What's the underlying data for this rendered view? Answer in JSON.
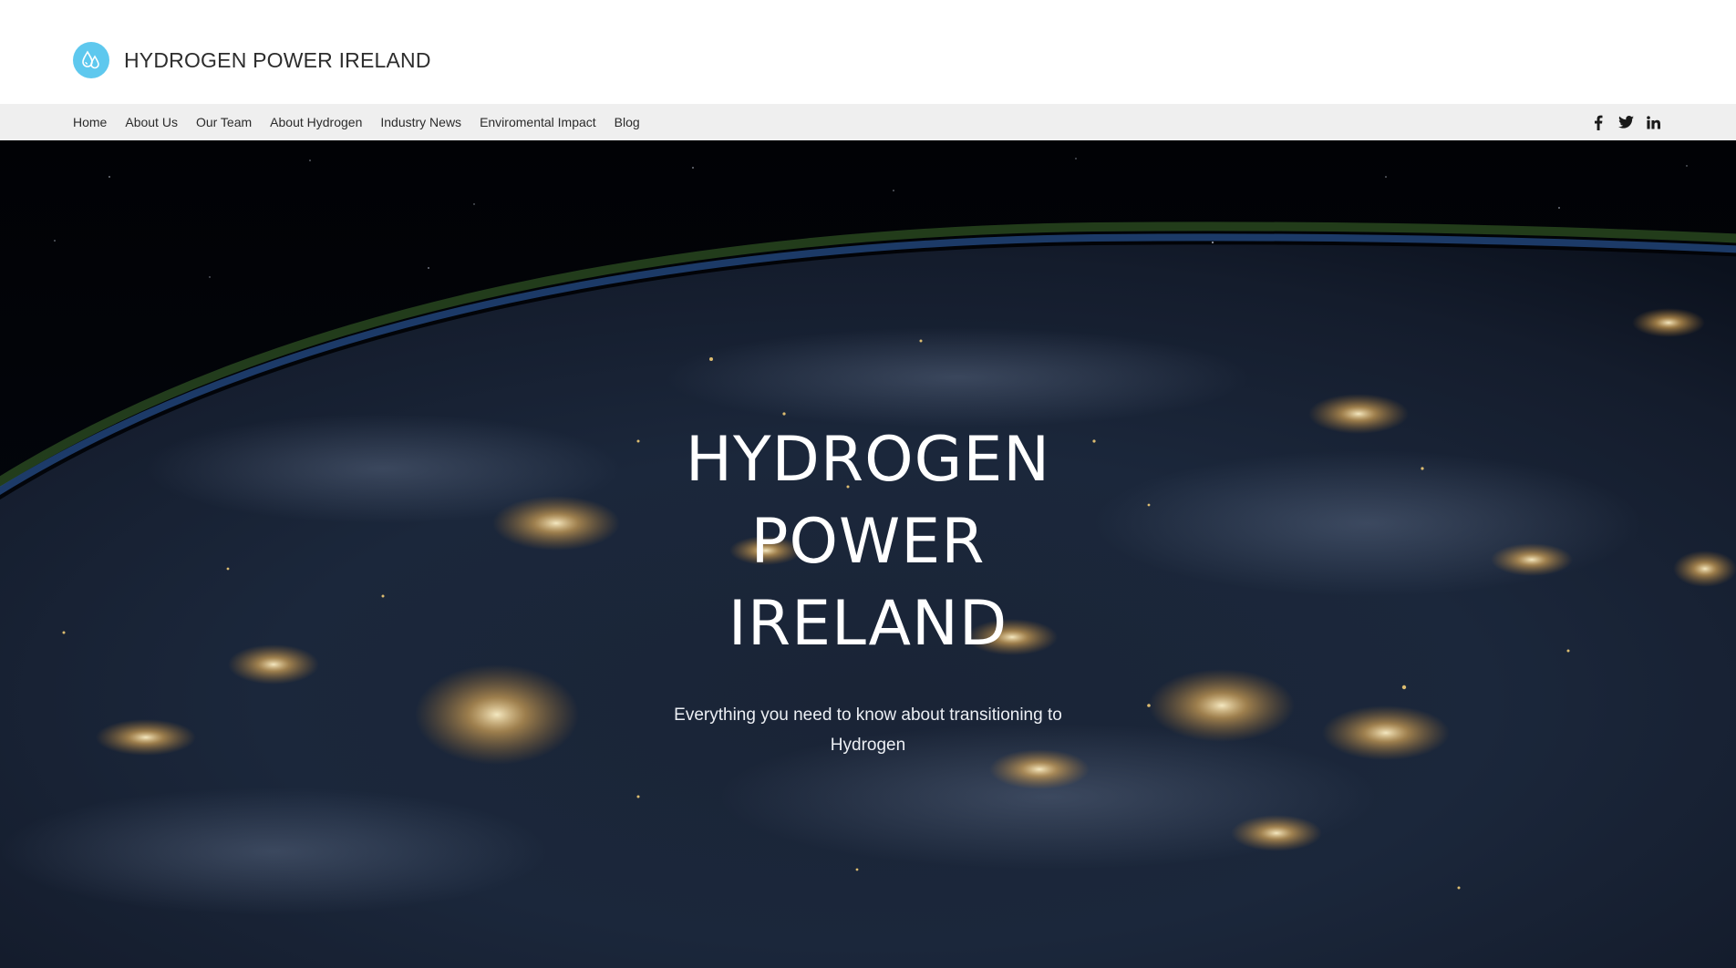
{
  "header": {
    "site_title": "HYDROGEN POWER IRELAND",
    "logo_icon": "water-drops-icon",
    "logo_color": "#5ec8ee"
  },
  "nav": {
    "items": [
      {
        "label": "Home"
      },
      {
        "label": "About Us"
      },
      {
        "label": "Our Team"
      },
      {
        "label": "About Hydrogen"
      },
      {
        "label": "Industry News"
      },
      {
        "label": "Enviromental Impact"
      },
      {
        "label": "Blog"
      }
    ],
    "background": "#efefef",
    "social": [
      {
        "icon": "facebook-icon"
      },
      {
        "icon": "twitter-icon"
      },
      {
        "icon": "linkedin-icon"
      }
    ]
  },
  "hero": {
    "title_lines": [
      "HYDROGEN",
      "POWER",
      "IRELAND"
    ],
    "subtitle": "Everything you need to know about transitioning to Hydrogen",
    "background_image": "earth-at-night-from-space"
  }
}
